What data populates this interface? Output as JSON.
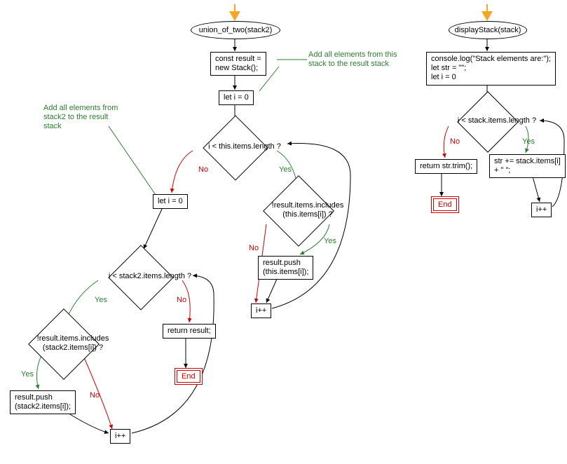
{
  "chart_data": [
    {
      "type": "flowchart",
      "title": "union_of_two(stack2)",
      "nodes": {
        "start": {
          "kind": "start-end",
          "label": "union_of_two(stack2)"
        },
        "init_result": {
          "kind": "process",
          "label": "const result =\nnew Stack();"
        },
        "i_zero_1": {
          "kind": "process",
          "label": "let i = 0"
        },
        "cond_this": {
          "kind": "decision",
          "label": "i < this.items.length ?"
        },
        "cond_includes_this": {
          "kind": "decision",
          "label": "!result.items.includes\n(this.items[i]) ?"
        },
        "push_this": {
          "kind": "process",
          "label": "result.push\n(this.items[i]);"
        },
        "inc_1": {
          "kind": "process",
          "label": "i++"
        },
        "i_zero_2": {
          "kind": "process",
          "label": "let i = 0"
        },
        "cond_stack2": {
          "kind": "decision",
          "label": "i < stack2.items.length ?"
        },
        "cond_includes_stack2": {
          "kind": "decision",
          "label": "!result.items.includes\n(stack2.items[i]) ?"
        },
        "push_stack2": {
          "kind": "process",
          "label": "result.push\n(stack2.items[i]);"
        },
        "inc_2": {
          "kind": "process",
          "label": "i++"
        },
        "return_result": {
          "kind": "process",
          "label": "return result;"
        },
        "end": {
          "kind": "start-end",
          "label": "End"
        }
      },
      "edges": [
        {
          "from": "start",
          "to": "init_result"
        },
        {
          "from": "init_result",
          "to": "i_zero_1"
        },
        {
          "from": "i_zero_1",
          "to": "cond_this"
        },
        {
          "from": "cond_this",
          "to": "cond_includes_this",
          "label": "Yes"
        },
        {
          "from": "cond_this",
          "to": "i_zero_2",
          "label": "No"
        },
        {
          "from": "cond_includes_this",
          "to": "push_this",
          "label": "Yes"
        },
        {
          "from": "cond_includes_this",
          "to": "inc_1",
          "label": "No"
        },
        {
          "from": "push_this",
          "to": "inc_1"
        },
        {
          "from": "inc_1",
          "to": "cond_this"
        },
        {
          "from": "i_zero_2",
          "to": "cond_stack2"
        },
        {
          "from": "cond_stack2",
          "to": "cond_includes_stack2",
          "label": "Yes"
        },
        {
          "from": "cond_stack2",
          "to": "return_result",
          "label": "No"
        },
        {
          "from": "cond_includes_stack2",
          "to": "push_stack2",
          "label": "Yes"
        },
        {
          "from": "cond_includes_stack2",
          "to": "inc_2",
          "label": "No"
        },
        {
          "from": "push_stack2",
          "to": "inc_2"
        },
        {
          "from": "inc_2",
          "to": "cond_stack2"
        },
        {
          "from": "return_result",
          "to": "end"
        }
      ],
      "comments": [
        {
          "text": "Add all elements from this\nstack to the result stack",
          "attached_to": "i_zero_1"
        },
        {
          "text": "Add all elements from\nstack2 to the result\nstack",
          "attached_to": "i_zero_2"
        }
      ]
    },
    {
      "type": "flowchart",
      "title": "displayStack(stack)",
      "nodes": {
        "start2": {
          "kind": "start-end",
          "label": "displayStack(stack)"
        },
        "init2": {
          "kind": "process",
          "label": "console.log(\"Stack elements are:\");\nlet str = \"\";\nlet i = 0"
        },
        "cond2": {
          "kind": "decision",
          "label": "i < stack.items.length ?"
        },
        "append2": {
          "kind": "process",
          "label": "str += stack.items[i]\n+ \" \";"
        },
        "inc2": {
          "kind": "process",
          "label": "i++"
        },
        "return2": {
          "kind": "process",
          "label": "return str.trim();"
        },
        "end2": {
          "kind": "start-end",
          "label": "End"
        }
      },
      "edges": [
        {
          "from": "start2",
          "to": "init2"
        },
        {
          "from": "init2",
          "to": "cond2"
        },
        {
          "from": "cond2",
          "to": "append2",
          "label": "Yes"
        },
        {
          "from": "cond2",
          "to": "return2",
          "label": "No"
        },
        {
          "from": "append2",
          "to": "inc2"
        },
        {
          "from": "inc2",
          "to": "cond2"
        },
        {
          "from": "return2",
          "to": "end2"
        }
      ]
    }
  ],
  "labels": {
    "yes": "Yes",
    "no": "No",
    "end": "End"
  }
}
